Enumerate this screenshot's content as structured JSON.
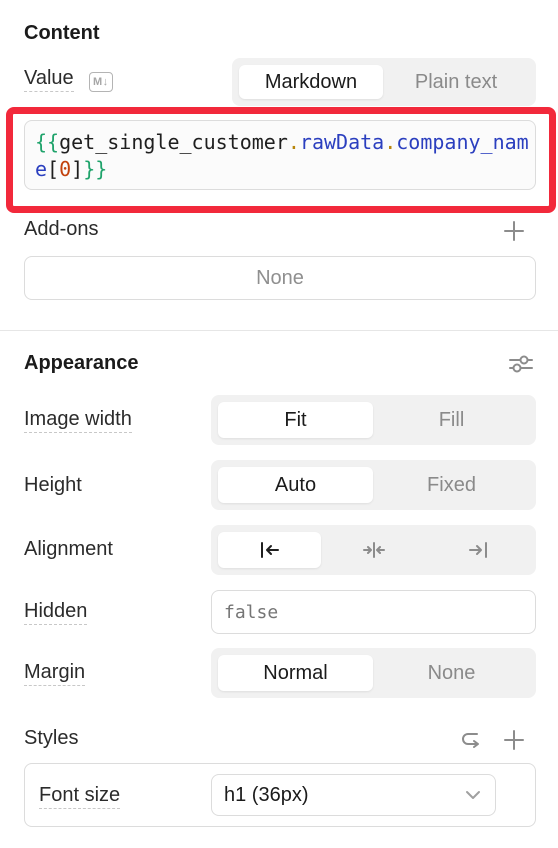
{
  "content": {
    "title": "Content",
    "value_label": "Value",
    "md_badge": "M↓",
    "value_mode": {
      "options": [
        "Markdown",
        "Plain text"
      ],
      "selected": "Markdown"
    },
    "code": {
      "open": "{{",
      "ident": "get_single_customer",
      "dot1": ".",
      "prop1": "rawData",
      "dot2": ".",
      "prop2": "company_nam",
      "prop2b": "e",
      "lbr": "[",
      "index": "0",
      "rbr": "]",
      "close": "}}"
    },
    "addons_label": "Add-ons",
    "addons_value": "None"
  },
  "appearance": {
    "title": "Appearance",
    "image_width": {
      "label": "Image width",
      "options": [
        "Fit",
        "Fill"
      ],
      "selected": "Fit"
    },
    "height": {
      "label": "Height",
      "options": [
        "Auto",
        "Fixed"
      ],
      "selected": "Auto"
    },
    "alignment": {
      "label": "Alignment",
      "options": [
        "align-left-icon",
        "align-center-icon",
        "align-right-icon"
      ],
      "selected": "align-left-icon"
    },
    "hidden": {
      "label": "Hidden",
      "placeholder": "false"
    },
    "margin": {
      "label": "Margin",
      "options": [
        "Normal",
        "None"
      ],
      "selected": "Normal"
    }
  },
  "styles": {
    "title": "Styles",
    "font_size": {
      "label": "Font size",
      "value": "h1 (36px)"
    }
  },
  "colors": {
    "highlight": "#f2293b",
    "code_brace": "#1fa36b",
    "code_ident": "#1f1f1f",
    "code_dot": "#b8860b",
    "code_prop": "#2b3fbf",
    "code_index": "#c2410c"
  }
}
